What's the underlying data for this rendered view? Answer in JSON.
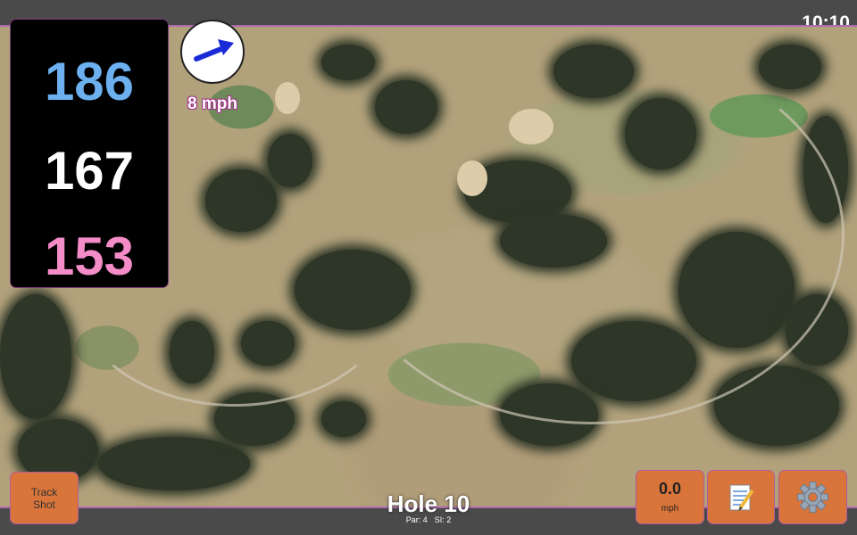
{
  "status_bar": {
    "time": "10:10"
  },
  "distances": {
    "back": "186",
    "center": "167",
    "front": "153"
  },
  "wind": {
    "speed_label": "8 mph",
    "direction_icon": "arrow-icon",
    "arrow_color": "#1a2bd6"
  },
  "buttons": {
    "track_shot_line1": "Track",
    "track_shot_line2": "Shot",
    "speed_value": "0.0",
    "speed_unit": "mph",
    "notes_icon": "notepad-icon",
    "settings_icon": "gear-icon"
  },
  "hole": {
    "title": "Hole 10",
    "par": "Par: 4",
    "si": "SI: 2"
  },
  "colors": {
    "back": "#6cb0f0",
    "center": "#ffffff",
    "front": "#f48cc8",
    "button": "#d9753a",
    "border": "#b06ab0"
  }
}
